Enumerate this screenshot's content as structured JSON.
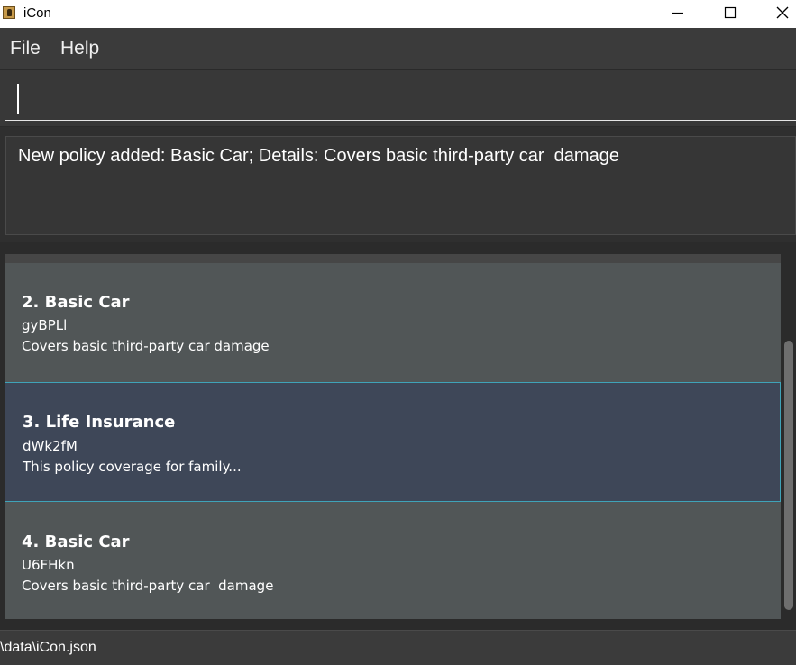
{
  "window": {
    "title": "iCon"
  },
  "menu": {
    "file": "File",
    "help": "Help"
  },
  "command": {
    "value": ""
  },
  "result": {
    "text": "New policy added: Basic Car; Details: Covers basic third-party car  damage"
  },
  "policies": [
    {
      "title": "2. Basic Car",
      "id": "gyBPLl",
      "description": "Covers basic third-party car damage"
    },
    {
      "title": "3. Life Insurance",
      "id": "dWk2fM",
      "description": "This policy coverage for family..."
    },
    {
      "title": "4. Basic Car",
      "id": "U6FHkn",
      "description": "Covers basic third-party car  damage"
    }
  ],
  "status": {
    "path": "\\data\\iCon.json"
  },
  "colors": {
    "background": "#2b2b2b",
    "card": "#515657",
    "card_selected": "#3e4758",
    "selected_border": "#3fa3b8"
  }
}
